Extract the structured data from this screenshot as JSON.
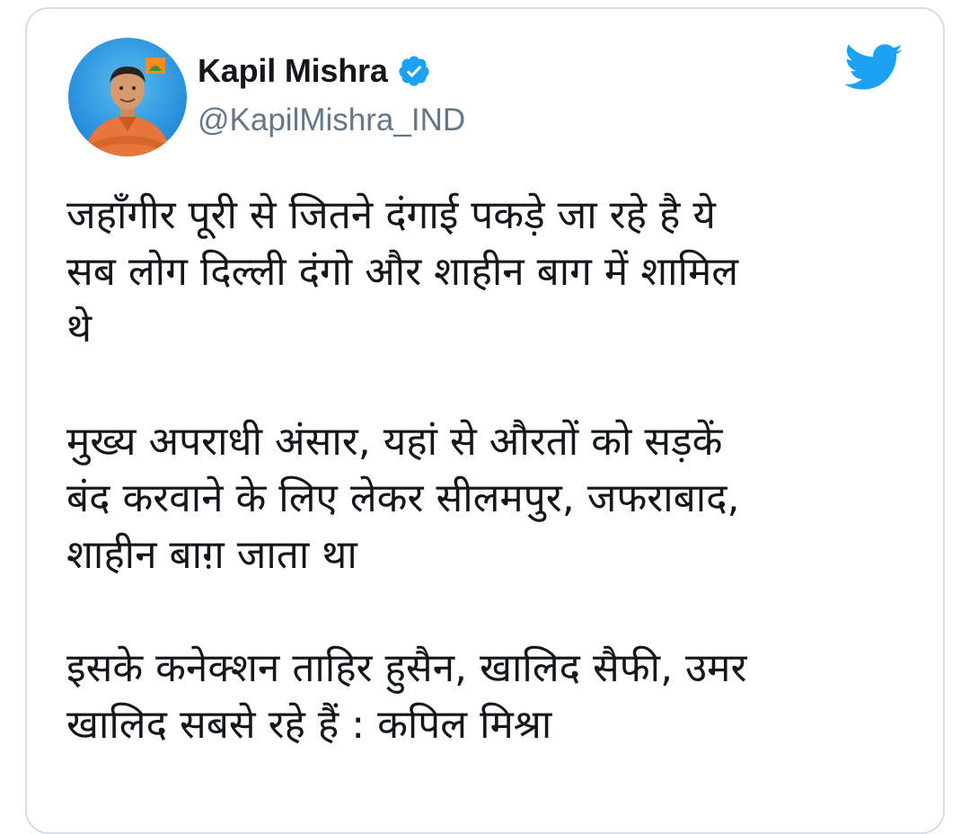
{
  "tweet": {
    "author_name": "Kapil Mishra",
    "handle": "@KapilMishra_IND",
    "verified": true,
    "paragraphs": [
      "जहाँगीर पूरी से जितने दंगाई पकड़े जा रहे है ये\nसब लोग दिल्ली दंगो और शाहीन बाग में शामिल\nथे",
      "मुख्य अपराधी अंसार, यहां से औरतों को सड़कें\nबंद करवाने के लिए लेकर सीलमपुर, जफराबाद,\nशाहीन बाग़ जाता था",
      "इसके कनेक्शन ताहिर हुसैन, खालिद सैफी, उमर\nखालिद सबसे रहे हैं  : कपिल मिश्रा"
    ]
  },
  "icons": {
    "verified": "verified-badge-icon",
    "logo": "twitter-bird-icon",
    "avatar": "profile-avatar"
  },
  "colors": {
    "twitter_blue": "#1da1f2",
    "text": "#14171a",
    "handle": "#657786",
    "border": "#d7dde2"
  }
}
